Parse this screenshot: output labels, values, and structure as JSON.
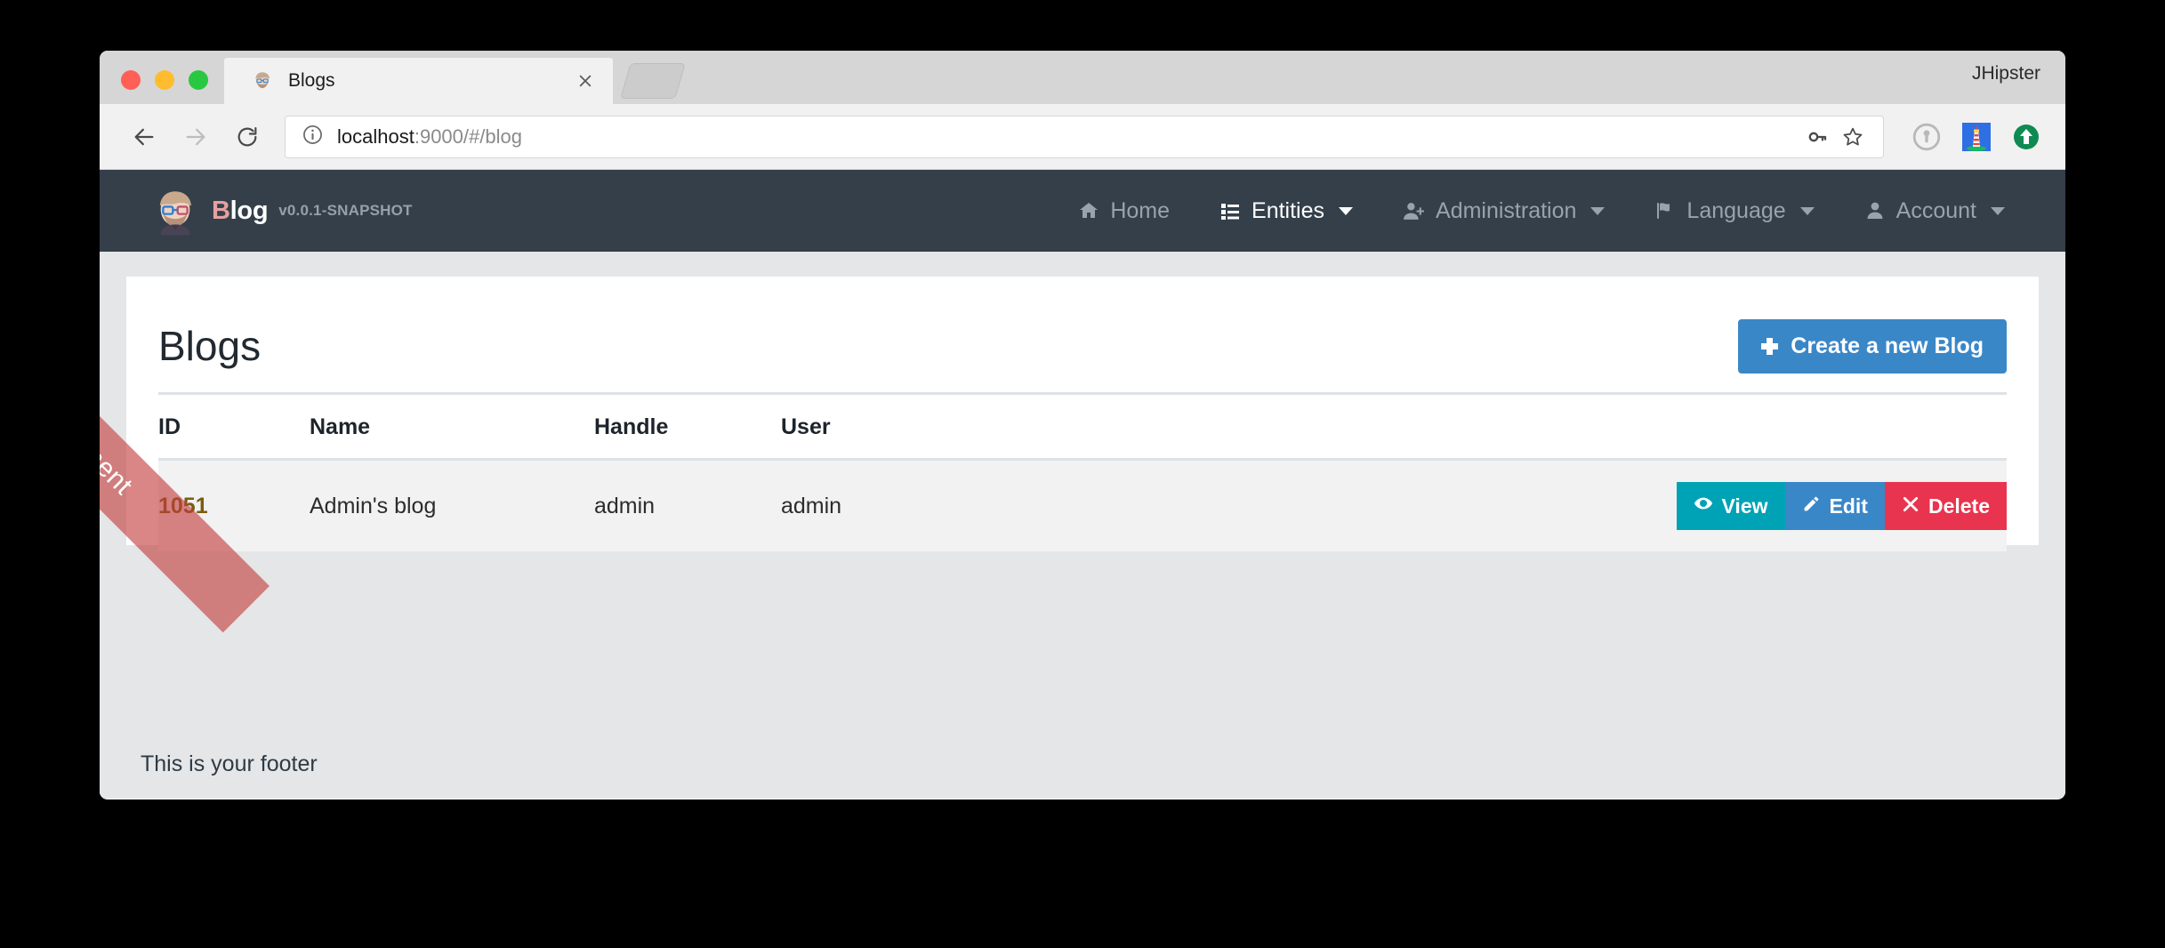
{
  "browser": {
    "profile_name": "JHipster",
    "tab": {
      "title": "Blogs",
      "favicon": "jhipster-avatar-icon",
      "close": "close-icon"
    },
    "newtab_label": "",
    "nav": {
      "back": "back-arrow-icon",
      "forward": "forward-arrow-icon",
      "reload": "reload-icon"
    },
    "omnibox": {
      "info_icon": "info-circle-icon",
      "url_host": "localhost",
      "url_rest": ":9000/#/blog",
      "url_full": "localhost:9000/#/blog",
      "key_icon": "key-icon",
      "star_icon": "star-icon"
    },
    "extensions": [
      {
        "name": "1password-icon"
      },
      {
        "name": "lighthouse-icon"
      },
      {
        "name": "upload-arrow-icon"
      }
    ]
  },
  "app": {
    "ribbon_label": "Development",
    "navbar": {
      "logo": "jhipster-avatar-icon",
      "brand_first": "B",
      "brand_rest": "log",
      "version": "v0.0.1-SNAPSHOT",
      "links": [
        {
          "label": "Home",
          "icon": "home-icon",
          "caret": false,
          "active": false
        },
        {
          "label": "Entities",
          "icon": "list-icon",
          "caret": true,
          "active": true
        },
        {
          "label": "Administration",
          "icon": "user-plus-icon",
          "caret": true,
          "active": false
        },
        {
          "label": "Language",
          "icon": "flag-icon",
          "caret": true,
          "active": false
        },
        {
          "label": "Account",
          "icon": "user-icon",
          "caret": true,
          "active": false
        }
      ]
    },
    "page": {
      "title": "Blogs",
      "create_button": "Create a new Blog",
      "create_icon": "plus-icon"
    },
    "table": {
      "columns": [
        "ID",
        "Name",
        "Handle",
        "User"
      ],
      "rows": [
        {
          "id": "1051",
          "name": "Admin's blog",
          "handle": "admin",
          "user": "admin",
          "actions": [
            {
              "label": "View",
              "icon": "eye-icon",
              "style": "view"
            },
            {
              "label": "Edit",
              "icon": "pencil-icon",
              "style": "edit"
            },
            {
              "label": "Delete",
              "icon": "times-icon",
              "style": "delete"
            }
          ]
        }
      ]
    },
    "footer": "This is your footer"
  },
  "colors": {
    "navbar_bg": "#343f4a",
    "primary": "#3a87c8",
    "view": "#00a3b5",
    "delete": "#e8344e",
    "ribbon": "#c43c3c",
    "id_link": "#7a5c12"
  }
}
